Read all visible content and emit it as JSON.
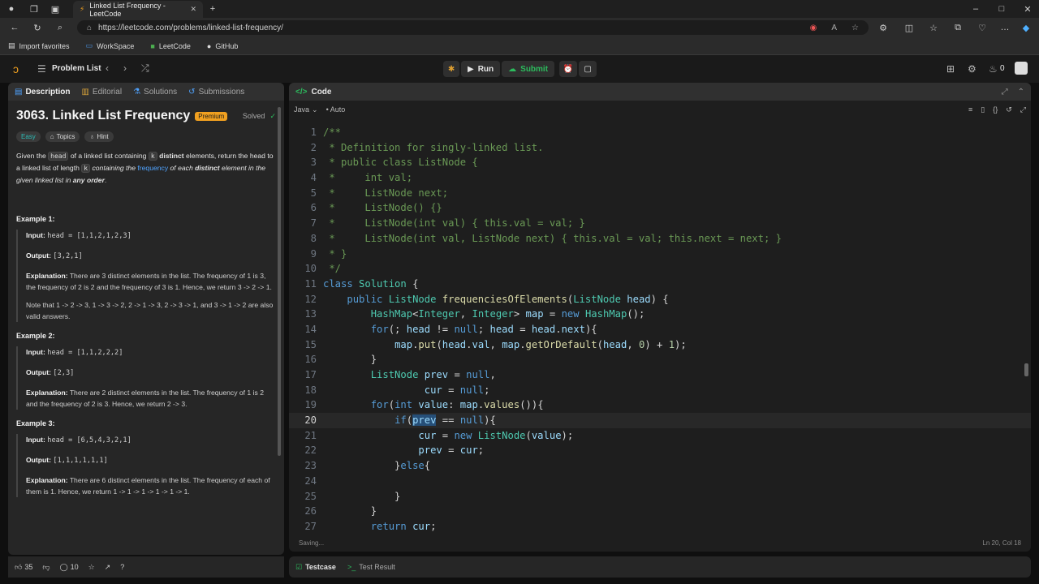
{
  "browser": {
    "tab_title": "Linked List Frequency - LeetCode",
    "url": "https://leetcode.com/problems/linked-list-frequency/",
    "bookmarks": [
      "Import favorites",
      "WorkSpace",
      "LeetCode",
      "GitHub"
    ]
  },
  "nav": {
    "problem_list": "Problem List",
    "run": "Run",
    "submit": "Submit",
    "streak": "0"
  },
  "left": {
    "tabs": [
      "Description",
      "Editorial",
      "Solutions",
      "Submissions"
    ],
    "title": "3063. Linked List Frequency",
    "premium": "Premium",
    "solved": "Solved",
    "chips": [
      "Easy",
      "Topics",
      "Hint"
    ],
    "desc": {
      "p1": "Given the ",
      "c1": "head",
      "p2": " of a linked list containing ",
      "c2": "k",
      "p3": " distinct",
      "p4": " elements, return the head to a linked list of length ",
      "c3": "k",
      "p5": " containing the ",
      "link": "frequency",
      "p6": " of each ",
      "p7": "distinct",
      "p8": " element in the given linked list in ",
      "p9": "any order",
      "p10": "."
    },
    "examples": [
      {
        "title": "Example 1:",
        "input": "head = [1,1,2,1,2,3]",
        "output": "[3,2,1]",
        "explanation": "There are 3 distinct elements in the list. The frequency of 1 is 3, the frequency of 2 is 2 and the frequency of 3 is 1. Hence, we return 3 -> 2 -> 1.",
        "note": "Note that 1 -> 2 -> 3, 1 -> 3 -> 2, 2 -> 1 -> 3, 2 -> 3 -> 1, and 3 -> 1 -> 2 are also valid answers."
      },
      {
        "title": "Example 2:",
        "input": "head = [1,1,2,2,2]",
        "output": "[2,3]",
        "explanation": "There are 2 distinct elements in the list. The frequency of 1 is 2 and the frequency of 2 is 3. Hence, we return 2 -> 3."
      },
      {
        "title": "Example 3:",
        "input": "head = [6,5,4,3,2,1]",
        "output": "[1,1,1,1,1,1]",
        "explanation": "There are 6 distinct elements in the list. The frequency of each of them is 1. Hence, we return 1 -> 1 -> 1 -> 1 -> 1 -> 1."
      }
    ],
    "labels": {
      "input": "Input:",
      "output": "Output:",
      "explanation": "Explanation:"
    },
    "likes": "35",
    "comments": "10"
  },
  "code": {
    "header": "Code",
    "language": "Java",
    "mode": "Auto",
    "saving": "Saving...",
    "cursor": "Ln 20, Col 18"
  },
  "bottom": {
    "testcase": "Testcase",
    "test_result": "Test Result"
  }
}
